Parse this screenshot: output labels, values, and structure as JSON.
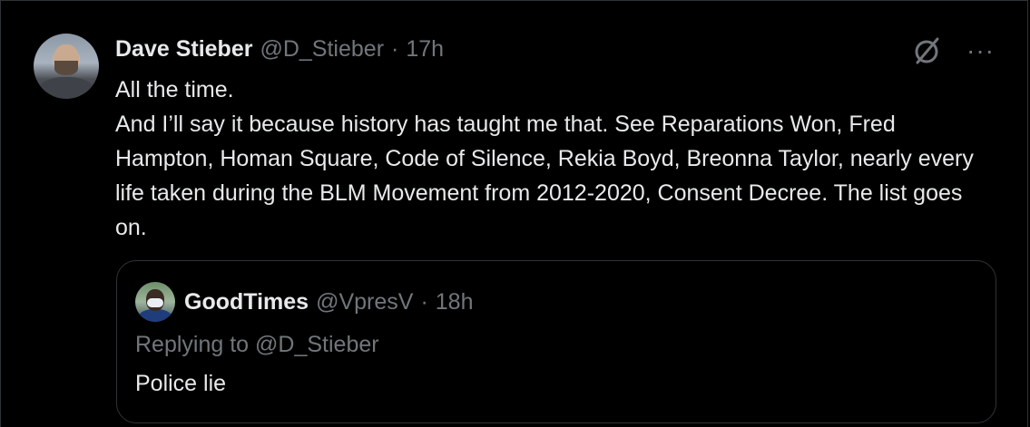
{
  "tweet": {
    "author_name": "Dave Stieber",
    "author_handle": "@D_Stieber",
    "separator": "·",
    "timestamp": "17h",
    "lines": [
      "All the time.",
      "And I’ll say it because history has taught me that. See Reparations Won, Fred Hampton, Homan Square, Code of Silence, Rekia Boyd, Breonna Taylor, nearly every life taken during the BLM Movement from 2012-2020, Consent Decree. The list goes on."
    ],
    "icons": {
      "grok": "grok-icon",
      "more": "more-icon"
    },
    "more_glyph": "···"
  },
  "quoted": {
    "author_name": "GoodTimes",
    "author_handle": "@VpresV",
    "separator": "·",
    "timestamp": "18h",
    "replying_prefix": "Replying to",
    "replying_handle": "@D_Stieber",
    "text": "Police lie"
  },
  "colors": {
    "background": "#000000",
    "primary_text": "#e7e9ea",
    "secondary_text": "#71767b",
    "border": "#2f3336"
  }
}
